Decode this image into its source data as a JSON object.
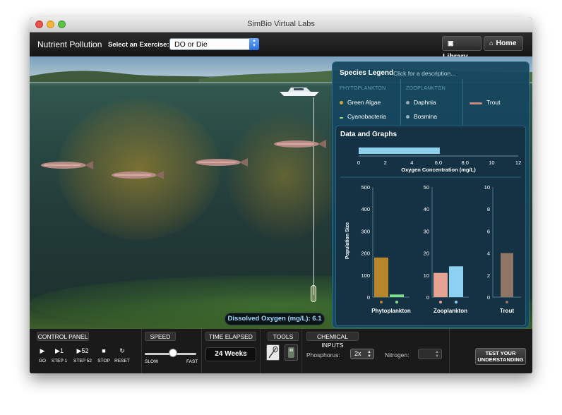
{
  "window": {
    "title": "SimBio Virtual Labs"
  },
  "header": {
    "app_title": "Nutrient Pollution",
    "exercise_label": "Select an Exercise:",
    "exercise_value": "DO or Die",
    "library_label": "Library",
    "home_label": "Home"
  },
  "scene": {
    "dissolved_oxygen_label": "Dissolved Oxygen (mg/L): 6.1"
  },
  "legend": {
    "title": "Species Legend",
    "hint": "Click for a description...",
    "phytoplankton_header": "PHYTOPLANKTON",
    "zooplankton_header": "ZOOPLANKTON",
    "species": {
      "green_algae": "Green Algae",
      "cyanobacteria": "Cyanobacteria",
      "daphnia": "Daphnia",
      "bosmina": "Bosmina",
      "trout": "Trout"
    }
  },
  "graphs": {
    "title": "Data and Graphs",
    "population_axis_label": "Population Size"
  },
  "chart_data": [
    {
      "type": "bar",
      "orientation": "horizontal",
      "xlabel": "Oxygen Concentration (mg/L)",
      "xlim": [
        0,
        12
      ],
      "xticks": [
        "0",
        "2",
        "4",
        "6.0",
        "8.0",
        "10",
        "12"
      ],
      "values": [
        6.1
      ],
      "colors": [
        "#8fd0ef"
      ]
    },
    {
      "type": "bar",
      "xlabel": "Phytoplankton",
      "ylabel": "Population Size",
      "ylim": [
        0,
        500
      ],
      "yticks": [
        "0",
        "100",
        "200",
        "300",
        "400",
        "500"
      ],
      "categories": [
        "Green Algae",
        "Cyanobacteria"
      ],
      "values": [
        180,
        12
      ],
      "colors": [
        "#b8862a",
        "#7fe087"
      ]
    },
    {
      "type": "bar",
      "xlabel": "Zooplankton",
      "ylim": [
        0,
        50
      ],
      "yticks": [
        "0",
        "10",
        "20",
        "30",
        "40",
        "50"
      ],
      "categories": [
        "Daphnia",
        "Bosmina"
      ],
      "values": [
        11,
        14
      ],
      "colors": [
        "#e6a293",
        "#8cd0f2"
      ]
    },
    {
      "type": "bar",
      "xlabel": "Trout",
      "ylim": [
        0,
        10
      ],
      "yticks": [
        "0",
        "2",
        "4",
        "6",
        "8",
        "10"
      ],
      "categories": [
        "Trout"
      ],
      "values": [
        4
      ],
      "colors": [
        "#8f7565"
      ]
    }
  ],
  "controls": {
    "control_panel_label": "CONTROL PANEL",
    "speed_label": "SPEED",
    "time_elapsed_label": "TIME ELAPSED",
    "tools_label": "TOOLS",
    "chemical_inputs_label": "CHEMICAL INPUTS",
    "go_label": "GO",
    "step1_label": "STEP 1",
    "step52_label": "STEP 52",
    "step1_glyph": "▶1",
    "step52_glyph": "▶52",
    "stop_label": "STOP",
    "reset_label": "RESET",
    "slow_label": "SLOW",
    "fast_label": "FAST",
    "speed_level": 0.55,
    "time_elapsed_value": "24 Weeks",
    "phosphorus_label": "Phosphorus:",
    "phosphorus_value": "2x",
    "nitrogen_label": "Nitrogen:",
    "test_button_line1": "TEST YOUR",
    "test_button_line2": "UNDERSTANDING"
  }
}
